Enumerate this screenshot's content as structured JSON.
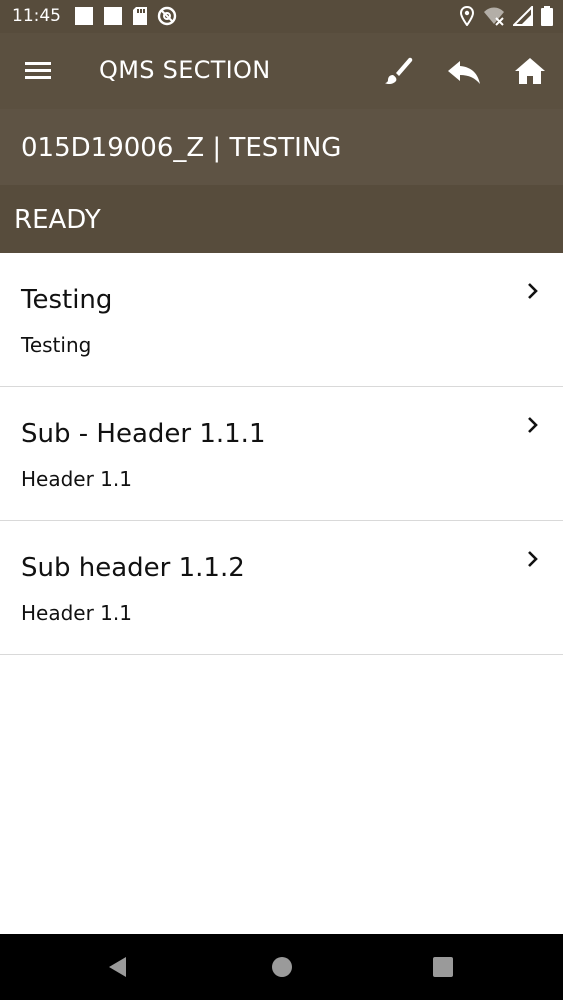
{
  "status_bar": {
    "time": "11:45",
    "left_icons": [
      "square-notification-icon",
      "square-notification-icon",
      "sd-card-icon",
      "vpn-block-icon"
    ],
    "right_icons": [
      "location-pin-icon",
      "wifi-off-icon",
      "signal-icon",
      "battery-icon"
    ]
  },
  "toolbar": {
    "title": "QMS SECTION",
    "actions": [
      "menu-icon",
      "brush-icon",
      "reply-icon",
      "home-icon"
    ]
  },
  "subheader": {
    "text": "015D19006_Z | TESTING"
  },
  "state": {
    "text": "READY"
  },
  "list": {
    "items": [
      {
        "title": "Testing",
        "subtitle": "Testing"
      },
      {
        "title": "Sub - Header 1.1.1",
        "subtitle": "Header 1.1"
      },
      {
        "title": "Sub header 1.1.2",
        "subtitle": "Header 1.1"
      }
    ]
  },
  "navigation_bar": {
    "buttons": [
      "back-icon",
      "home-circle-icon",
      "recents-square-icon"
    ]
  },
  "colors": {
    "toolbar_bg": "#5b5040",
    "subheader_bg": "#5e5344",
    "status_bg": "#574c3c",
    "nav_bg": "#000000"
  }
}
